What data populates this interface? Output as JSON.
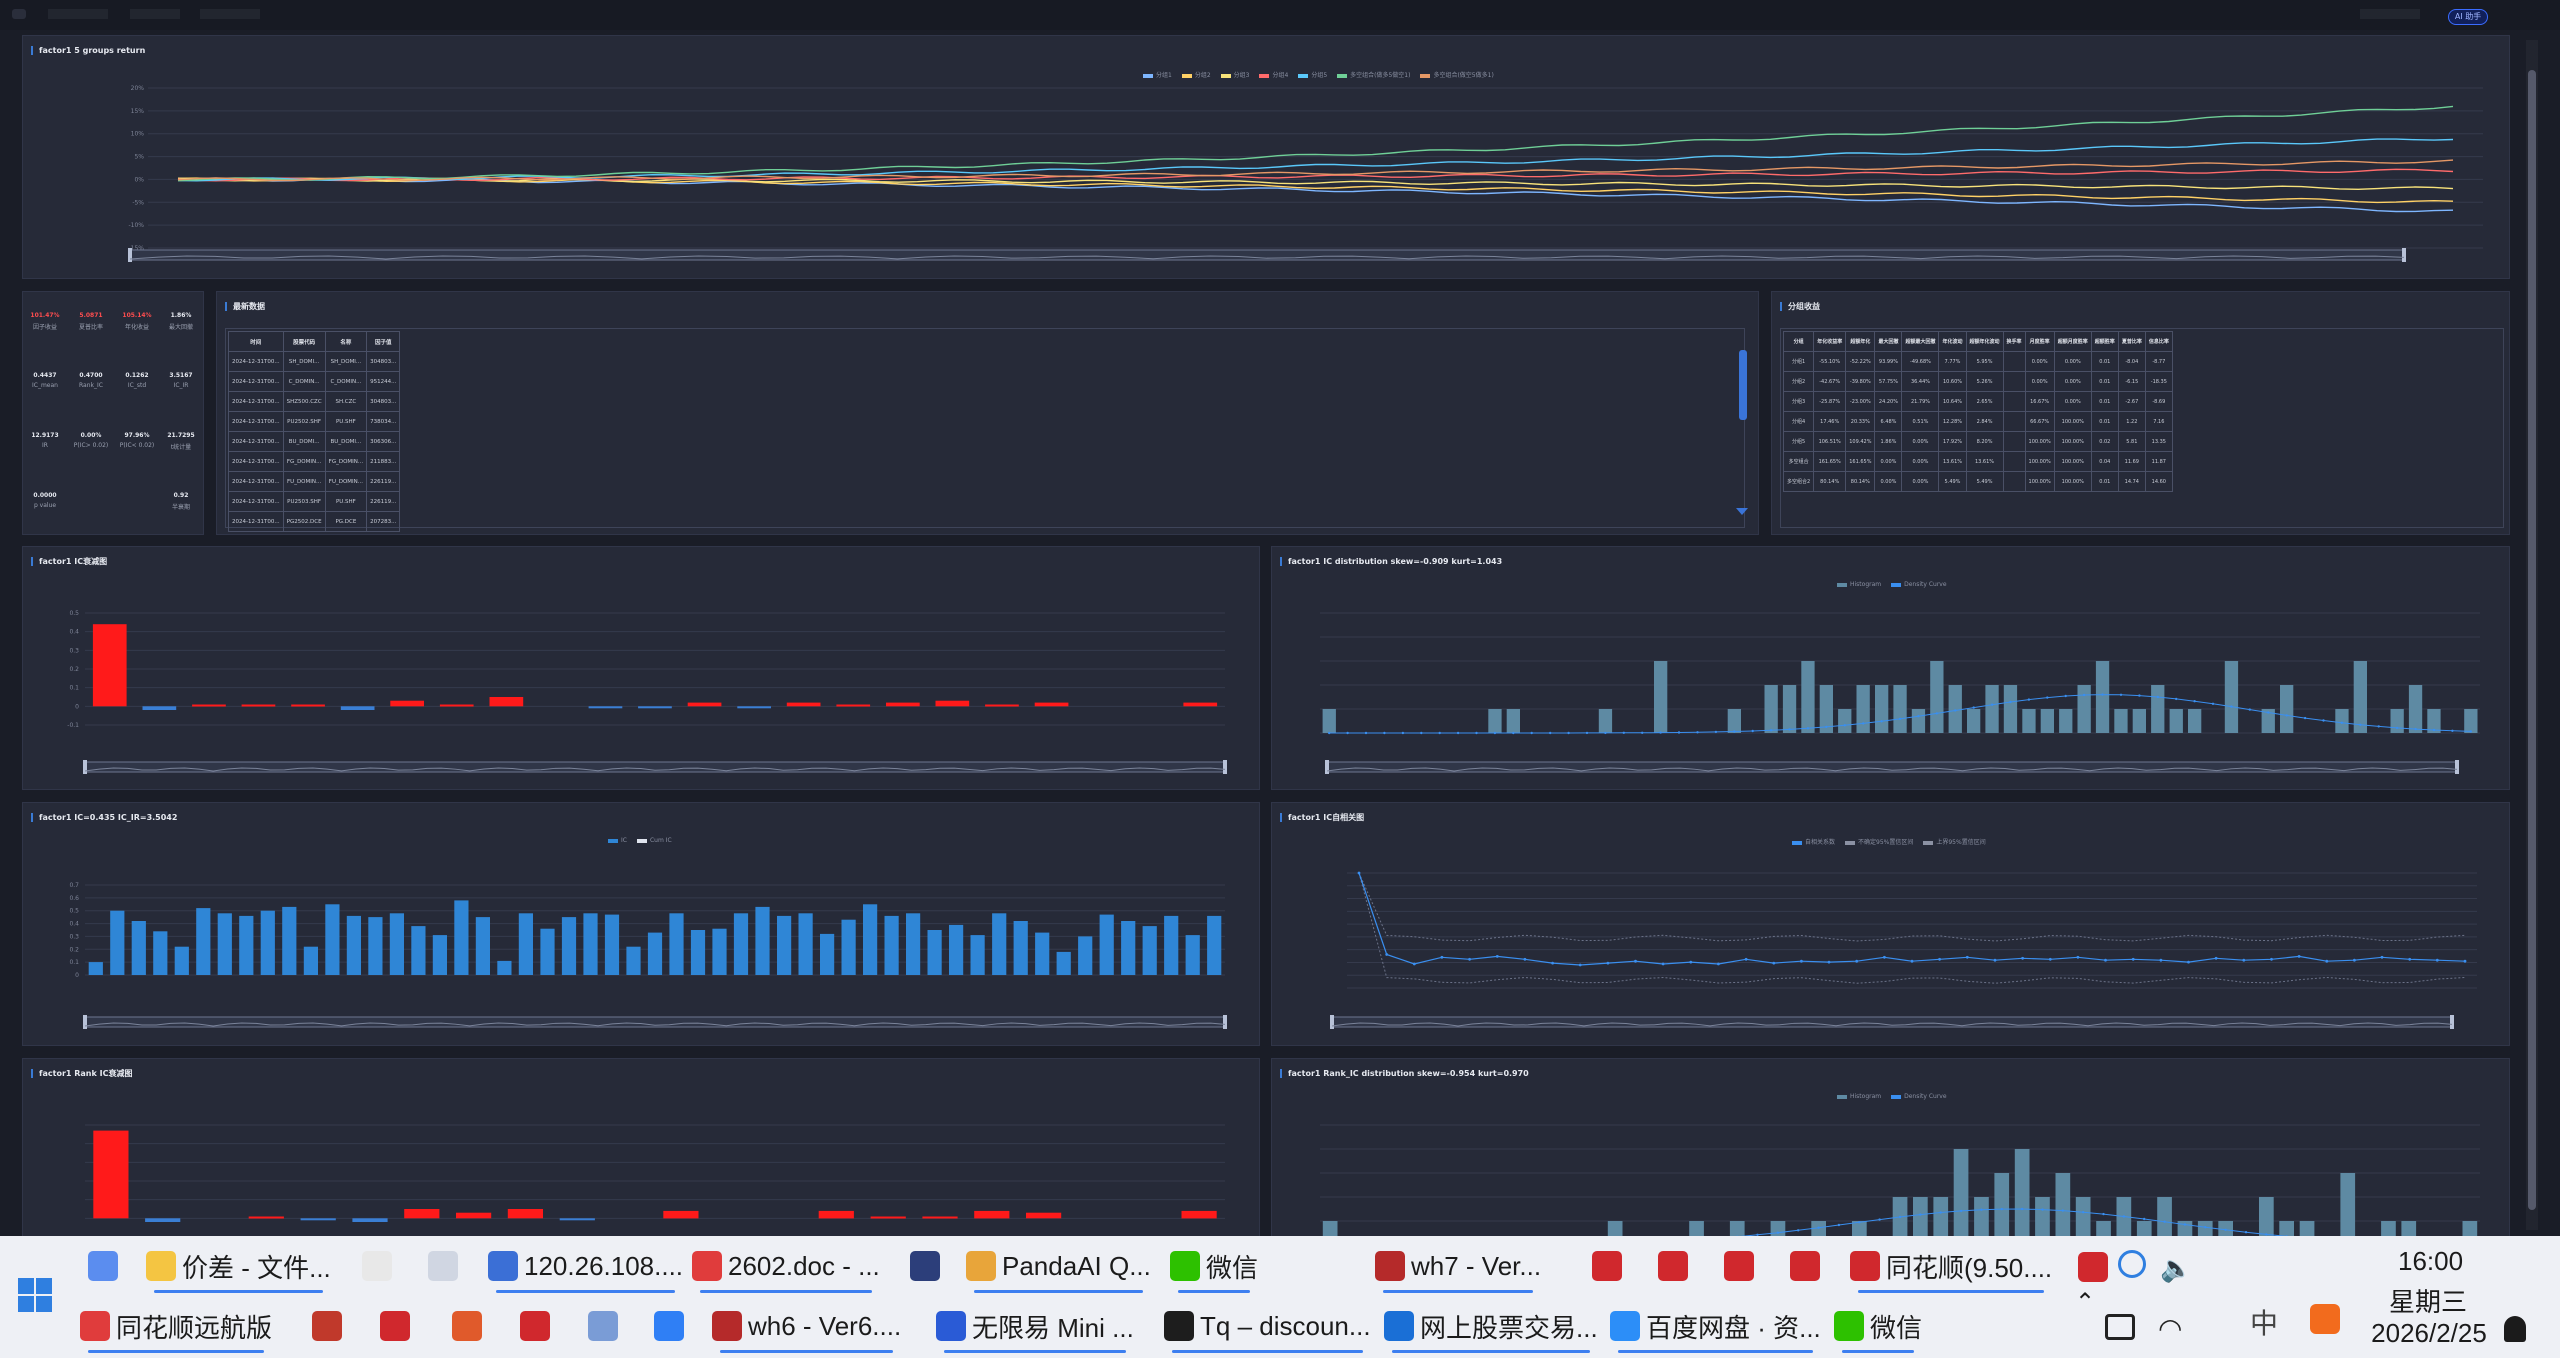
{
  "app": {
    "topbar_items": [
      "·",
      "·",
      "·",
      "·"
    ],
    "badge": "AI 助手"
  },
  "panels": {
    "groups_return": {
      "title": "factor1 5 groups return",
      "legend": [
        "分组1",
        "分组2",
        "分组3",
        "分组4",
        "分组5",
        "多空组合(做多5做空1)",
        "多空组合(做空5做多1)"
      ],
      "y_ticks": [
        "20%",
        "15%",
        "10%",
        "5%",
        "0%",
        "-5%",
        "-10%",
        "-15%"
      ]
    },
    "summary": {
      "top": [
        {
          "value": "101.47%",
          "label": "因子收益",
          "red": true
        },
        {
          "value": "5.0871",
          "label": "夏普比率",
          "red": true
        },
        {
          "value": "105.14%",
          "label": "年化收益",
          "red": true
        },
        {
          "value": "1.86%",
          "label": "最大回撤",
          "red": false
        }
      ],
      "mid": [
        {
          "value": "0.4437",
          "label": "IC_mean"
        },
        {
          "value": "0.4700",
          "label": "Rank_IC"
        },
        {
          "value": "0.1262",
          "label": "IC_std"
        },
        {
          "value": "3.5167",
          "label": "IC_IR"
        }
      ],
      "row3": [
        {
          "value": "12.9173",
          "label": "IR"
        },
        {
          "value": "0.00%",
          "label": "P(IC> 0.02)"
        },
        {
          "value": "97.96%",
          "label": "P(IC< 0.02)"
        },
        {
          "value": "21.7295",
          "label": "t统计量"
        }
      ],
      "row4": [
        {
          "value": "0.0000",
          "label": "p value"
        },
        {
          "value": "0.92",
          "label": "半衰期"
        }
      ]
    },
    "latest": {
      "title": "最新数据",
      "headers": [
        "时间",
        "股票代码",
        "名称",
        "因子值"
      ],
      "rows": [
        [
          "2024-12-31T00...",
          "SH_DOMI...",
          "SH_DOMI...",
          "304803..."
        ],
        [
          "2024-12-31T00...",
          "C_DOMIN...",
          "C_DOMIN...",
          "951244..."
        ],
        [
          "2024-12-31T00...",
          "SHZ500.CZC",
          "SH.CZC",
          "304803..."
        ],
        [
          "2024-12-31T00...",
          "PU2502.SHF",
          "PU.SHF",
          "738034..."
        ],
        [
          "2024-12-31T00...",
          "BU_DOMI...",
          "BU_DOMI...",
          "306306..."
        ],
        [
          "2024-12-31T00...",
          "FG_DOMIN...",
          "FG_DOMIN...",
          "211883..."
        ],
        [
          "2024-12-31T00...",
          "FU_DOMIN...",
          "FU_DOMIN...",
          "226119..."
        ],
        [
          "2024-12-31T00...",
          "PU2503.SHF",
          "PU.SHF",
          "226119..."
        ],
        [
          "2024-12-31T00...",
          "PG2502.DCE",
          "PG.DCE",
          "207283..."
        ]
      ]
    },
    "group_perf": {
      "title": "分组收益",
      "headers": [
        "分组",
        "年化收益率",
        "超额年化",
        "最大回撤",
        "超额最大回撤",
        "年化波动",
        "超额年化波动",
        "换手率",
        "月度胜率",
        "超额月度胜率",
        "超额胜率",
        "夏普比率",
        "信息比率"
      ],
      "rows": [
        [
          "分组1",
          "-55.10%",
          "-52.22%",
          "93.99%",
          "-49.68%",
          "7.77%",
          "5.95%",
          "",
          "0.00%",
          "0.00%",
          "0.01",
          "-8.04",
          "-8.77"
        ],
        [
          "分组2",
          "-42.67%",
          "-39.80%",
          "57.75%",
          "36.44%",
          "10.60%",
          "5.26%",
          "",
          "0.00%",
          "0.00%",
          "0.01",
          "-6.15",
          "-18.35"
        ],
        [
          "分组3",
          "-25.87%",
          "-23.00%",
          "24.20%",
          "21.79%",
          "10.64%",
          "2.65%",
          "",
          "16.67%",
          "0.00%",
          "0.01",
          "-2.67",
          "-8.69"
        ],
        [
          "分组4",
          "17.46%",
          "20.33%",
          "6.48%",
          "0.51%",
          "12.28%",
          "2.84%",
          "",
          "66.67%",
          "100.00%",
          "0.01",
          "1.22",
          "7.16"
        ],
        [
          "分组5",
          "106.51%",
          "109.42%",
          "1.86%",
          "0.00%",
          "17.92%",
          "8.20%",
          "",
          "100.00%",
          "100.00%",
          "0.02",
          "5.81",
          "13.35"
        ],
        [
          "多空组合",
          "161.65%",
          "161.65%",
          "0.00%",
          "0.00%",
          "13.61%",
          "13.61%",
          "",
          "100.00%",
          "100.00%",
          "0.04",
          "11.69",
          "11.87"
        ],
        [
          "多空组合2",
          "80.14%",
          "80.14%",
          "0.00%",
          "0.00%",
          "5.49%",
          "5.49%",
          "",
          "100.00%",
          "100.00%",
          "0.01",
          "14.74",
          "14.60"
        ]
      ]
    },
    "ic_decay": {
      "title": "factor1 IC衰减图",
      "y_ticks": [
        "0.5",
        "0.4",
        "0.3",
        "0.2",
        "0.1",
        "0",
        "-0.1"
      ]
    },
    "ic_dist": {
      "title": "factor1 IC distribution skew=-0.909 kurt=1.043",
      "legend": [
        "Histogram",
        "Density Curve"
      ]
    },
    "ic_series": {
      "title": "factor1 IC=0.435 IC_IR=3.5042",
      "legend": [
        "IC",
        "Cum IC"
      ],
      "y_ticks": [
        "0.7",
        "0.6",
        "0.5",
        "0.4",
        "0.3",
        "0.2",
        "0.1",
        "0"
      ]
    },
    "ic_autocorr": {
      "title": "factor1 IC自相关图",
      "legend": [
        "自相关系数",
        "不确定95%置信区间",
        "上界95%置信区间"
      ]
    },
    "rank_ic_decay": {
      "title": "factor1 Rank IC衰减图"
    },
    "rank_ic_dist": {
      "title": "factor1 Rank_IC distribution skew=-0.954 kurt=0.970",
      "legend": [
        "Histogram",
        "Density Curve"
      ]
    }
  },
  "chart_data": [
    {
      "type": "line",
      "title": "factor1 5 groups return",
      "series": [
        {
          "name": "分组1",
          "color": "#7eb6ff",
          "end": -0.07
        },
        {
          "name": "分组2",
          "color": "#ffd166",
          "end": -0.05
        },
        {
          "name": "分组3",
          "color": "#f7e27a",
          "end": -0.02
        },
        {
          "name": "分组4",
          "color": "#ff6b6b",
          "end": 0.02
        },
        {
          "name": "分组5",
          "color": "#5ac8fa",
          "end": 0.09
        },
        {
          "name": "多空组合(做多5做空1)",
          "color": "#6fcf97",
          "end": 0.16
        },
        {
          "name": "多空组合(做空5做多1)",
          "color": "#e59866",
          "end": 0.04
        }
      ],
      "ylim": [
        -0.15,
        0.2
      ]
    },
    {
      "type": "bar",
      "title": "factor1 IC衰减图",
      "values": [
        0.44,
        -0.02,
        0.01,
        0.01,
        0.01,
        -0.02,
        0.03,
        0.01,
        0.05,
        0.0,
        -0.01,
        -0.01,
        0.02,
        -0.01,
        0.02,
        0.01,
        0.02,
        0.03,
        0.01,
        0.02,
        0.0,
        0.0,
        0.02
      ],
      "ylim": [
        -0.1,
        0.5
      ]
    },
    {
      "type": "bar",
      "title": "factor1 IC distribution",
      "values": [
        1,
        0,
        0,
        0,
        0,
        0,
        0,
        0,
        0,
        1,
        1,
        0,
        0,
        0,
        0,
        1,
        0,
        0,
        3,
        0,
        0,
        0,
        1,
        0,
        2,
        2,
        3,
        2,
        1,
        2,
        2,
        2,
        1,
        3,
        2,
        1,
        2,
        2,
        1,
        1,
        1,
        2,
        3,
        1,
        1,
        2,
        1,
        1,
        0,
        3,
        0,
        1,
        2,
        0,
        0,
        1,
        3,
        0,
        1,
        2,
        1,
        0,
        1
      ],
      "ylim": [
        0,
        5
      ]
    },
    {
      "type": "bar",
      "title": "factor1 IC=0.435 IC_IR=3.5042",
      "values": [
        0.1,
        0.5,
        0.42,
        0.34,
        0.22,
        0.52,
        0.48,
        0.46,
        0.5,
        0.53,
        0.22,
        0.55,
        0.46,
        0.45,
        0.48,
        0.38,
        0.31,
        0.58,
        0.45,
        0.11,
        0.48,
        0.36,
        0.45,
        0.48,
        0.47,
        0.22,
        0.33,
        0.48,
        0.35,
        0.36,
        0.48,
        0.53,
        0.46,
        0.48,
        0.32,
        0.43,
        0.55,
        0.46,
        0.48,
        0.35,
        0.39,
        0.31,
        0.48,
        0.42,
        0.33,
        0.18,
        0.3,
        0.47,
        0.42,
        0.38,
        0.46,
        0.31,
        0.46
      ],
      "ylim": [
        0,
        0.7
      ]
    },
    {
      "type": "line",
      "title": "factor1 IC自相关图",
      "values": [
        1.0,
        0.15,
        0.05,
        0.12,
        0.1,
        0.13,
        0.1,
        0.06,
        0.04,
        0.06,
        0.08,
        0.05,
        0.07,
        0.05,
        0.1,
        0.06,
        0.08,
        0.07,
        0.08,
        0.12,
        0.08,
        0.1,
        0.12,
        0.09,
        0.11,
        0.1,
        0.12,
        0.09,
        0.1,
        0.09,
        0.07,
        0.11,
        0.09,
        0.1,
        0.13,
        0.08,
        0.09,
        0.12,
        0.1,
        0.09,
        0.08
      ],
      "ylim": [
        -0.2,
        1.0
      ]
    },
    {
      "type": "bar",
      "title": "factor1 Rank IC衰减图",
      "values": [
        0.47,
        -0.02,
        0.0,
        0.01,
        -0.01,
        -0.02,
        0.05,
        0.03,
        0.05,
        -0.01,
        0.0,
        0.04,
        0.0,
        0.0,
        0.04,
        0.01,
        0.01,
        0.04,
        0.03,
        0.0,
        0.0,
        0.04
      ],
      "ylim": [
        -0.1,
        0.5
      ]
    },
    {
      "type": "bar",
      "title": "factor1 Rank_IC distribution",
      "values": [
        1,
        0,
        0,
        0,
        0,
        0,
        0,
        0,
        0,
        0,
        0,
        0,
        0,
        0,
        1,
        0,
        0,
        0,
        1,
        0,
        1,
        0,
        1,
        0,
        1,
        0,
        1,
        0,
        2,
        2,
        2,
        4,
        2,
        3,
        4,
        2,
        3,
        2,
        1,
        2,
        1,
        2,
        1,
        1,
        1,
        0,
        2,
        1,
        1,
        0,
        3,
        0,
        1,
        1,
        0,
        0,
        1
      ],
      "ylim": [
        0,
        5
      ]
    }
  ],
  "taskbar": {
    "row1": [
      {
        "label": "",
        "icon": "vc-app-icon",
        "color": "#5b8def"
      },
      {
        "label": "价差 - 文件...",
        "icon": "folder-icon",
        "color": "#f4c542"
      },
      {
        "label": "",
        "icon": "chart-app-icon",
        "color": "#e8e8e8"
      },
      {
        "label": "",
        "icon": "network-icon",
        "color": "#d0d6e2"
      },
      {
        "label": "120.26.108....",
        "icon": "remote-desktop-icon",
        "color": "#3b6fd6"
      },
      {
        "label": "2602.doc - ...",
        "icon": "wps-icon",
        "color": "#e03c3c"
      },
      {
        "label": "",
        "icon": "compass-icon",
        "color": "#2c3e7a"
      },
      {
        "label": "PandaAI Q...",
        "icon": "chrome-icon",
        "color": "#e8a53a"
      },
      {
        "label": "微信",
        "icon": "wechat-icon",
        "color": "#2dc100"
      },
      {
        "label": "wh7 - Ver...",
        "icon": "wh7-icon",
        "color": "#b52a2a"
      },
      {
        "label": "",
        "icon": "app-red1-icon",
        "color": "#d0282d"
      },
      {
        "label": "",
        "icon": "app-red2-icon",
        "color": "#d0282d"
      },
      {
        "label": "",
        "icon": "app-red3-icon",
        "color": "#d0282d"
      },
      {
        "label": "",
        "icon": "app-red4-icon",
        "color": "#d0282d"
      },
      {
        "label": "同花顺(9.50....",
        "icon": "tonghuashun-icon",
        "color": "#d0282d"
      }
    ],
    "row2": [
      {
        "label": "同花顺远航版",
        "icon": "tonghuashun-voyage-icon",
        "color": "#e03c3c"
      },
      {
        "label": "",
        "icon": "app-h-icon",
        "color": "#c0392b"
      },
      {
        "label": "",
        "icon": "app-circle-icon",
        "color": "#d0282d"
      },
      {
        "label": "",
        "icon": "app-swirl-icon",
        "color": "#e05a2b"
      },
      {
        "label": "",
        "icon": "app-s-icon",
        "color": "#d0282d"
      },
      {
        "label": "",
        "icon": "stock-chart-icon",
        "color": "#7a9cd6"
      },
      {
        "label": "",
        "icon": "feishu-icon",
        "color": "#2f7ff5"
      },
      {
        "label": "wh6 - Ver6....",
        "icon": "wh6-icon",
        "color": "#b52a2a"
      },
      {
        "label": "无限易 Mini ...",
        "icon": "wuxianyi-icon",
        "color": "#2a5bd6"
      },
      {
        "label": "Tq – discoun...",
        "icon": "pycharm-icon",
        "color": "#1d1d1d"
      },
      {
        "label": "网上股票交易...",
        "icon": "stock-trade-icon",
        "color": "#1a6fd6"
      },
      {
        "label": "百度网盘 · 资...",
        "icon": "baidu-pan-icon",
        "color": "#2c8ef8"
      },
      {
        "label": "微信",
        "icon": "wechat-outline-icon",
        "color": "#2dc100"
      }
    ],
    "tray": {
      "ime": "中",
      "time": "16:00",
      "weekday": "星期三",
      "date": "2026/2/25"
    }
  }
}
